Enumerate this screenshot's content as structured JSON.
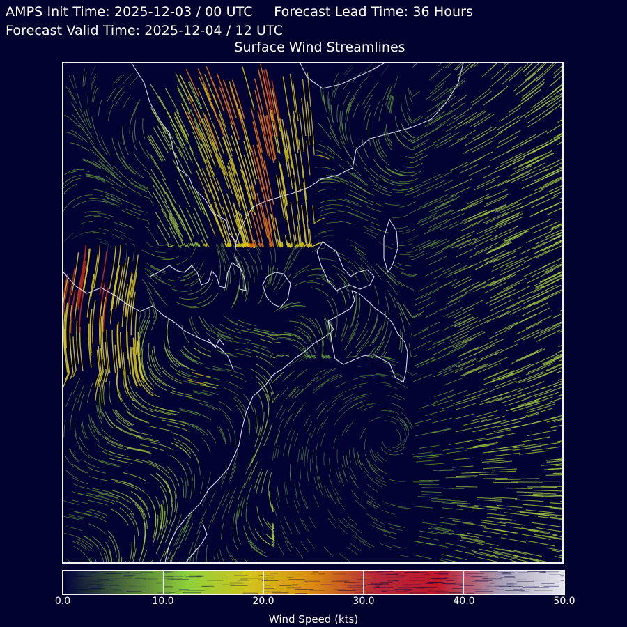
{
  "header": {
    "init_time": "AMPS Init Time: 2025-12-03 / 00 UTC",
    "lead_time": "Forecast Lead Time: 36 Hours",
    "valid_time": "Forecast Valid Time: 2025-12-04 / 12 UTC",
    "title": "Surface Wind Streamlines"
  },
  "colorbar": {
    "label": "Wind Speed (kts)",
    "ticks": [
      "0.0",
      "10.0",
      "20.0",
      "30.0",
      "40.0",
      "50.0"
    ],
    "range": [
      0,
      50
    ],
    "colors": {
      "stops": [
        "#02023a",
        "#4a6d3a",
        "#8fd13a",
        "#d2c21e",
        "#d98a10",
        "#b4283a",
        "#c0182a",
        "#a8a0b8",
        "#e6e6ee"
      ],
      "background": "#01012e",
      "coastline": "#d8d8e6"
    }
  },
  "map": {
    "streamline_color_scale": [
      "#3b6a48",
      "#6fae3a",
      "#a8d040",
      "#d2c21e",
      "#d26a16",
      "#b02818"
    ]
  }
}
